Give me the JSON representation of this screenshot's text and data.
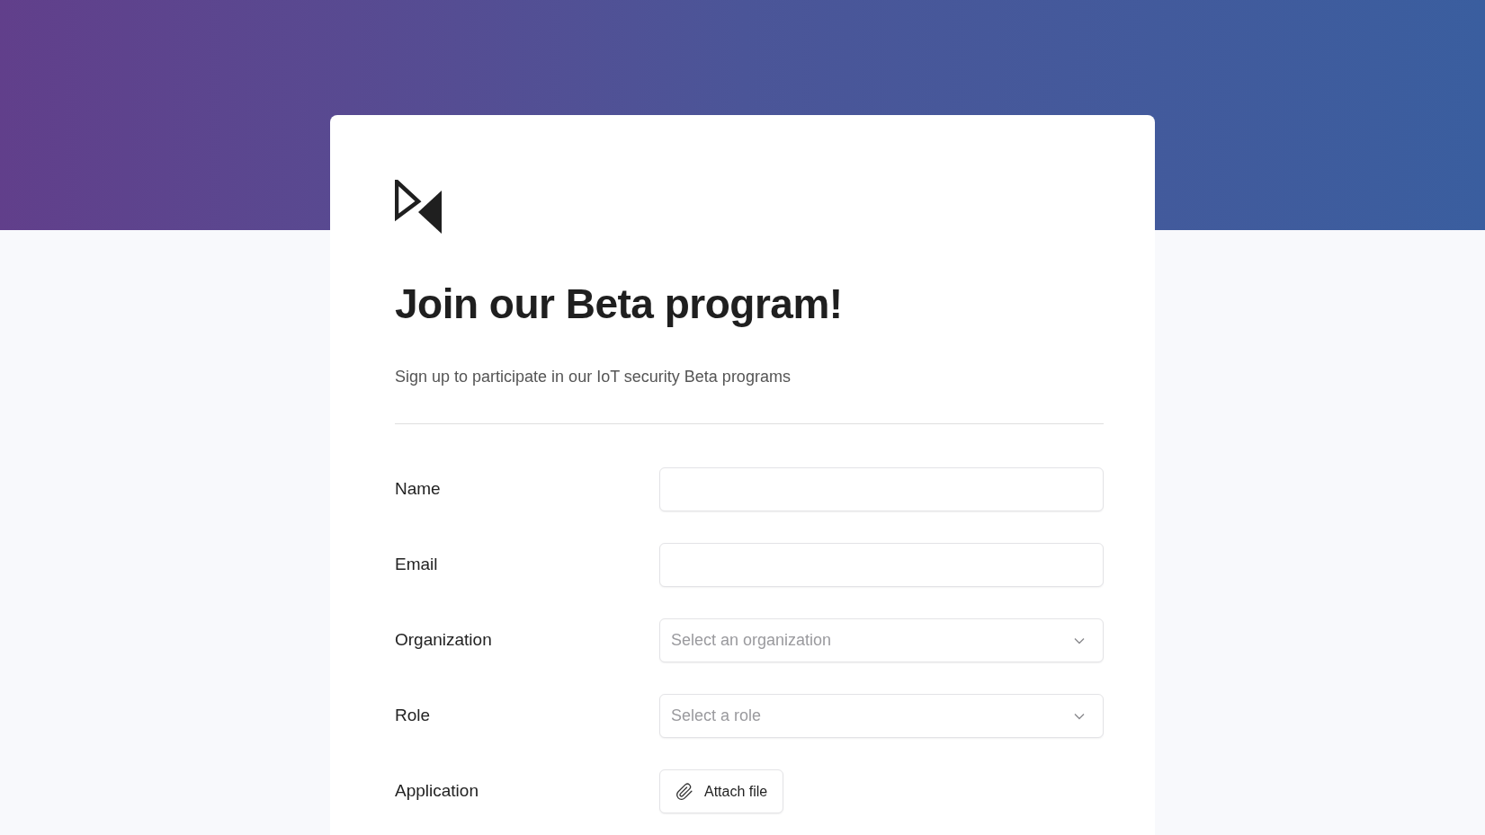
{
  "form": {
    "title": "Join our Beta program!",
    "subtitle": "Sign up to participate in our IoT security Beta programs",
    "fields": [
      {
        "kind": "text",
        "label": "Name"
      },
      {
        "kind": "text",
        "label": "Email"
      },
      {
        "kind": "select",
        "label": "Organization",
        "placeholder": "Select an organization"
      },
      {
        "kind": "select",
        "label": "Role",
        "placeholder": "Select a role"
      },
      {
        "kind": "file",
        "label": "Application",
        "button": "Attach file"
      }
    ]
  }
}
